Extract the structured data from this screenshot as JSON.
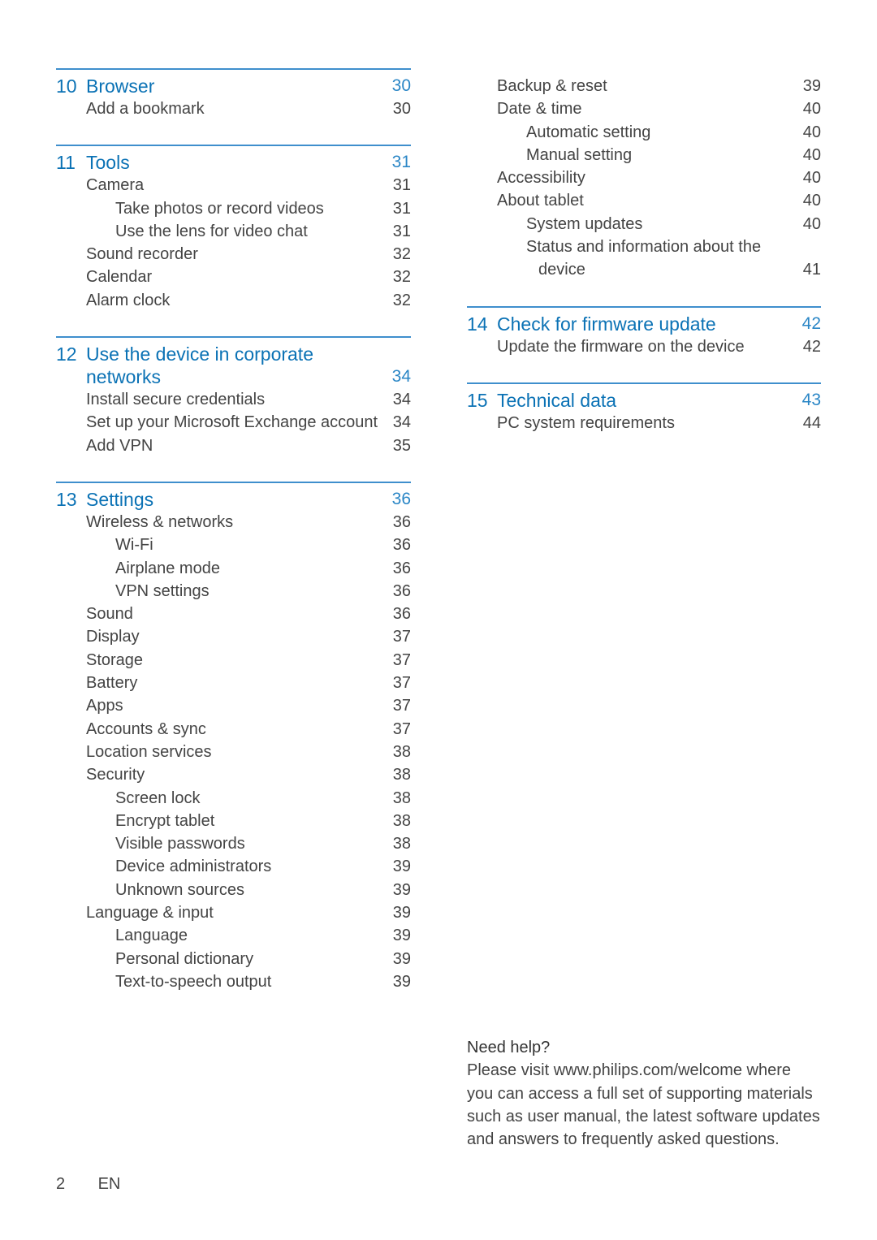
{
  "left_column": [
    {
      "num": "10",
      "title_lines": [
        "Browser"
      ],
      "page": "30",
      "entries": [
        {
          "level": 1,
          "label": "Add a bookmark",
          "page": "30"
        }
      ]
    },
    {
      "num": "11",
      "title_lines": [
        "Tools"
      ],
      "page": "31",
      "entries": [
        {
          "level": 1,
          "label": "Camera",
          "page": "31"
        },
        {
          "level": 2,
          "label": "Take photos or record videos",
          "page": "31"
        },
        {
          "level": 2,
          "label": "Use the lens for video chat",
          "page": "31"
        },
        {
          "level": 1,
          "label": "Sound recorder",
          "page": "32"
        },
        {
          "level": 1,
          "label": "Calendar",
          "page": "32"
        },
        {
          "level": 1,
          "label": "Alarm clock",
          "page": "32"
        }
      ]
    },
    {
      "num": "12",
      "title_lines": [
        "Use the device in corporate",
        "networks"
      ],
      "page": "34",
      "entries": [
        {
          "level": 1,
          "label": "Install secure credentials",
          "page": "34"
        },
        {
          "level": 1,
          "label": "Set up your Microsoft Exchange account",
          "page": "34"
        },
        {
          "level": 1,
          "label": "Add VPN",
          "page": "35"
        }
      ]
    },
    {
      "num": "13",
      "title_lines": [
        "Settings"
      ],
      "page": "36",
      "entries": [
        {
          "level": 1,
          "label": "Wireless & networks",
          "page": "36"
        },
        {
          "level": 2,
          "label": "Wi-Fi",
          "page": "36"
        },
        {
          "level": 2,
          "label": "Airplane mode",
          "page": "36"
        },
        {
          "level": 2,
          "label": "VPN settings",
          "page": "36"
        },
        {
          "level": 1,
          "label": "Sound",
          "page": "36"
        },
        {
          "level": 1,
          "label": "Display",
          "page": "37"
        },
        {
          "level": 1,
          "label": "Storage",
          "page": "37"
        },
        {
          "level": 1,
          "label": "Battery",
          "page": "37"
        },
        {
          "level": 1,
          "label": "Apps",
          "page": "37"
        },
        {
          "level": 1,
          "label": "Accounts & sync",
          "page": "37"
        },
        {
          "level": 1,
          "label": "Location services",
          "page": "38"
        },
        {
          "level": 1,
          "label": "Security",
          "page": "38"
        },
        {
          "level": 2,
          "label": "Screen lock",
          "page": "38"
        },
        {
          "level": 2,
          "label": "Encrypt tablet",
          "page": "38"
        },
        {
          "level": 2,
          "label": "Visible passwords",
          "page": "38"
        },
        {
          "level": 2,
          "label": "Device administrators",
          "page": "39"
        },
        {
          "level": 2,
          "label": "Unknown sources",
          "page": "39"
        },
        {
          "level": 1,
          "label": "Language & input",
          "page": "39"
        },
        {
          "level": 2,
          "label": "Language",
          "page": "39"
        },
        {
          "level": 2,
          "label": "Personal dictionary",
          "page": "39"
        },
        {
          "level": 2,
          "label": "Text-to-speech output",
          "page": "39"
        }
      ]
    }
  ],
  "right_column": {
    "continued_entries": [
      {
        "level": 1,
        "label": "Backup & reset",
        "page": "39"
      },
      {
        "level": 1,
        "label": "Date & time",
        "page": "40"
      },
      {
        "level": 2,
        "label": "Automatic setting",
        "page": "40"
      },
      {
        "level": 2,
        "label": "Manual setting",
        "page": "40"
      },
      {
        "level": 1,
        "label": "Accessibility",
        "page": "40"
      },
      {
        "level": 1,
        "label": "About tablet",
        "page": "40"
      },
      {
        "level": 2,
        "label": "System updates",
        "page": "40"
      },
      {
        "level": 2,
        "label": "Status and information about the",
        "page": ""
      },
      {
        "level": 3,
        "label": "device",
        "page": "41"
      }
    ],
    "sections": [
      {
        "num": "14",
        "title_lines": [
          "Check for firmware update"
        ],
        "page": "42",
        "entries": [
          {
            "level": 1,
            "label": "Update the firmware on the device",
            "page": "42"
          }
        ]
      },
      {
        "num": "15",
        "title_lines": [
          "Technical data"
        ],
        "page": "43",
        "entries": [
          {
            "level": 1,
            "label": "PC system requirements",
            "page": "44"
          }
        ]
      }
    ]
  },
  "help": {
    "title": "Need help?",
    "lines": [
      "Please visit www.philips.com/welcome where",
      "you can access a full set of supporting materials",
      "such as user manual, the latest software updates",
      "and answers to frequently asked questions."
    ]
  },
  "footer": {
    "page_number": "2",
    "language": "EN"
  },
  "colors": {
    "accent": "#0b72b5",
    "rule": "#3f8fcd",
    "text": "#444444"
  }
}
